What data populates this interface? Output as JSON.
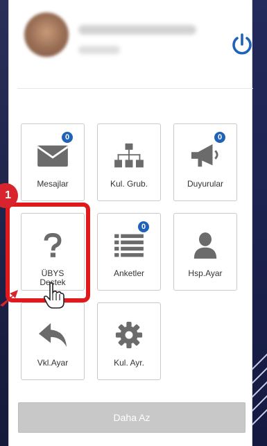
{
  "profile": {
    "power_icon": "power-icon"
  },
  "tiles": [
    {
      "label": "Mesajlar",
      "icon": "envelope-icon",
      "badge": "0"
    },
    {
      "label": "Kul. Grub.",
      "icon": "sitemap-icon",
      "badge": ""
    },
    {
      "label": "Duyurular",
      "icon": "megaphone-icon",
      "badge": "0"
    },
    {
      "label_line1": "ÜBYS",
      "label_line2": "Destek",
      "icon": "question-icon",
      "badge": ""
    },
    {
      "label": "Anketler",
      "icon": "list-icon",
      "badge": "0"
    },
    {
      "label": "Hsp.Ayar",
      "icon": "user-icon",
      "badge": ""
    },
    {
      "label": "Vkl.Ayar",
      "icon": "reply-icon",
      "badge": ""
    },
    {
      "label": "Kul. Ayr.",
      "icon": "gear-icon",
      "badge": ""
    }
  ],
  "annotation": {
    "step_number": "1",
    "highlight_color": "#e0191c"
  },
  "footer": {
    "less_label": "Daha Az"
  },
  "colors": {
    "accent": "#1f63b8",
    "icon_gray": "#6b6b6b",
    "button_gray": "#c8c8c8"
  }
}
